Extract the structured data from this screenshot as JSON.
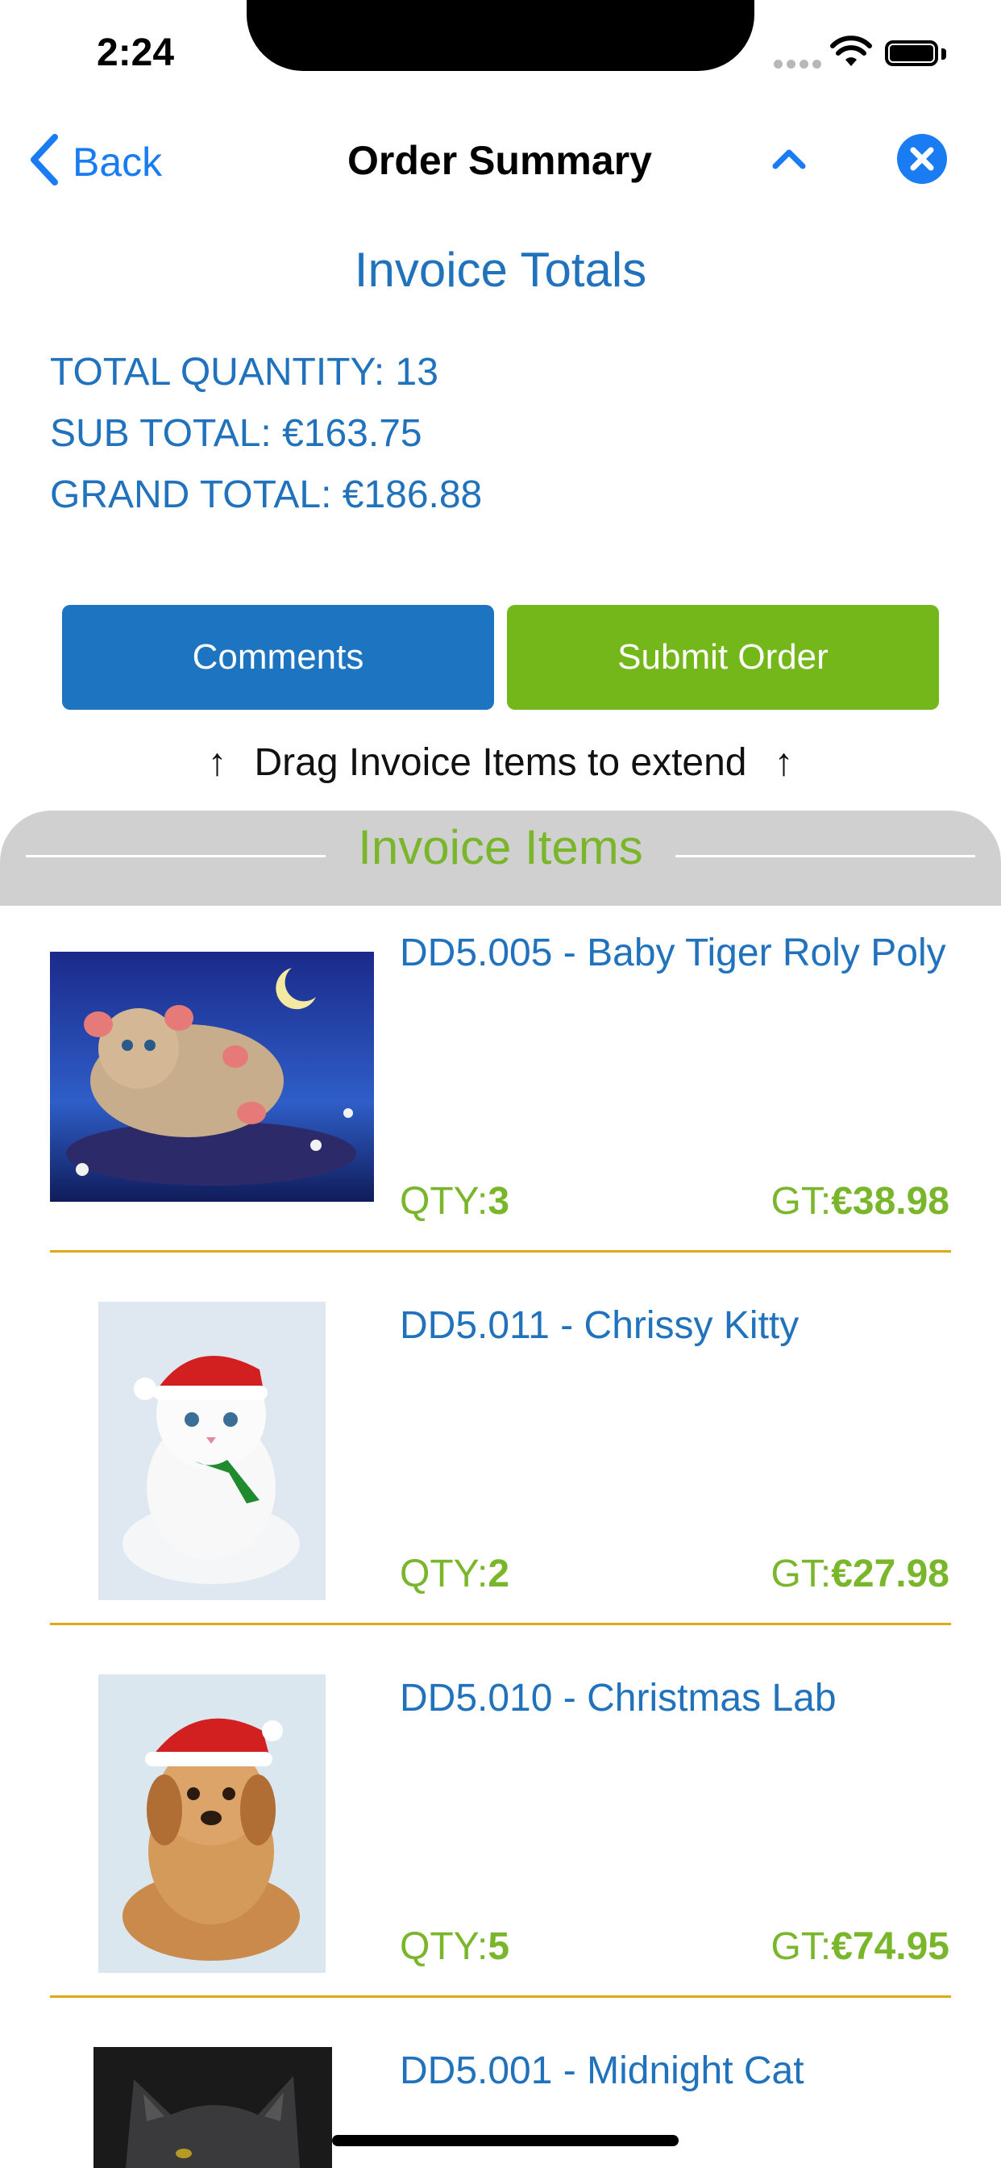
{
  "status_bar": {
    "time": "2:24"
  },
  "nav": {
    "back_label": "Back",
    "title": "Order Summary"
  },
  "totals": {
    "title": "Invoice Totals",
    "total_quantity": "TOTAL QUANTITY: 13",
    "sub_total": "SUB TOTAL: €163.75",
    "grand_total": "GRAND TOTAL: €186.88"
  },
  "actions": {
    "comments_label": "Comments",
    "submit_label": "Submit Order"
  },
  "drag_hint": {
    "left_arrow": "↑",
    "text": "Drag Invoice Items to extend",
    "right_arrow": "↑"
  },
  "items_header": {
    "title": "Invoice Items"
  },
  "items": [
    {
      "name": "DD5.005 - Baby Tiger Roly Poly",
      "qty_label": "QTY:",
      "qty": "3",
      "gt_label": "GT:",
      "gt": "€38.98"
    },
    {
      "name": "DD5.011 - Chrissy Kitty",
      "qty_label": "QTY:",
      "qty": "2",
      "gt_label": "GT:",
      "gt": "€27.98"
    },
    {
      "name": "DD5.010 - Christmas Lab",
      "qty_label": "QTY:",
      "qty": "5",
      "gt_label": "GT:",
      "gt": "€74.95"
    },
    {
      "name": "DD5.001 - Midnight Cat"
    }
  ],
  "colors": {
    "blue": "#2172bd",
    "green": "#74b71a",
    "divider": "#e0a918",
    "ios_blue": "#1a7cf2"
  }
}
